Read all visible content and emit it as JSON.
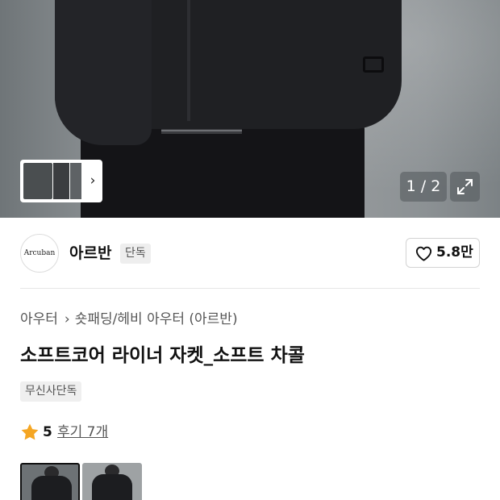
{
  "gallery": {
    "pager_text": "1 / 2",
    "expand_icon": "expand-icon",
    "thumb_next_icon": "chevron-right-icon"
  },
  "brand": {
    "logo_text": "Arcuban",
    "name": "아르반",
    "badge": "단독",
    "like_icon": "heart-icon",
    "like_count": "5.8만"
  },
  "product": {
    "breadcrumb": [
      "아우터",
      "숏패딩/헤비 아우터 (아르반)"
    ],
    "title": "소프트코어 라이너 자켓_소프트 차콜",
    "tag": "무신사단독",
    "rating_icon": "star-icon",
    "rating_value": "5",
    "review_link": "후기 7개"
  },
  "colors": {
    "star": "#f5a623",
    "text_primary": "#111111",
    "text_secondary": "#555555"
  }
}
